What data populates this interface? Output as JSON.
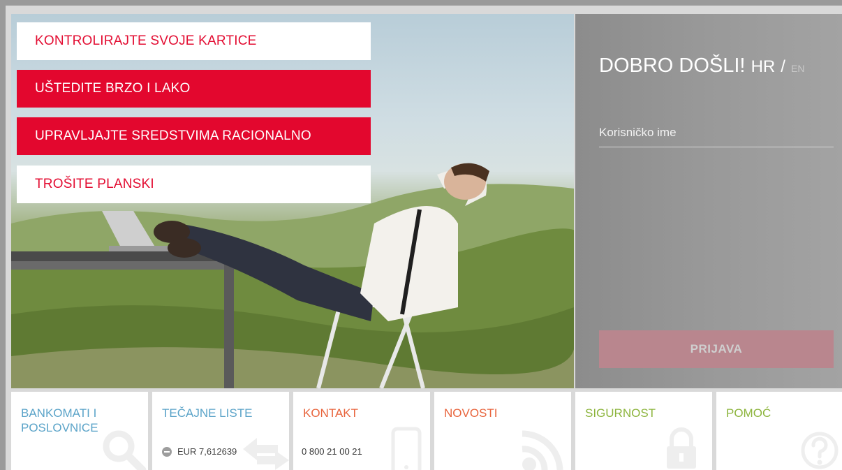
{
  "promos": [
    {
      "label": "KONTROLIRAJTE SVOJE KARTICE",
      "style": "white"
    },
    {
      "label": "UŠTEDITE BRZO I LAKO",
      "style": "red"
    },
    {
      "label": "UPRAVLJAJTE SREDSTVIMA RACIONALNO",
      "style": "red"
    },
    {
      "label": "TROŠITE PLANSKI",
      "style": "white"
    }
  ],
  "login": {
    "welcome": "DOBRO DOŠLI!",
    "lang_hr": "HR",
    "lang_sep": "/",
    "lang_en": "EN",
    "username_placeholder": "Korisničko ime",
    "submit_label": "PRIJAVA"
  },
  "tiles": {
    "atms": {
      "title": "BANKOMATI I POSLOVNICE",
      "icon": "search-icon",
      "color": "#5aa3c8"
    },
    "rates": {
      "title": "TEČAJNE LISTE",
      "rate": "EUR 7,612639",
      "icon": "exchange-arrows-icon",
      "color": "#5aa3c8"
    },
    "contact": {
      "title": "KONTAKT",
      "phone": "0 800 21 00 21",
      "icon": "mobile-phone-icon",
      "color": "#e8643c"
    },
    "news": {
      "title": "NOVOSTI",
      "icon": "rss-icon",
      "color": "#e8643c"
    },
    "security": {
      "title": "SIGURNOST",
      "icon": "lock-icon",
      "color": "#8cb43c"
    },
    "help": {
      "title": "POMOĆ",
      "icon": "question-icon",
      "color": "#8cb43c"
    }
  },
  "colors": {
    "brand_red": "#e3072e",
    "login_panel": "#999999"
  }
}
